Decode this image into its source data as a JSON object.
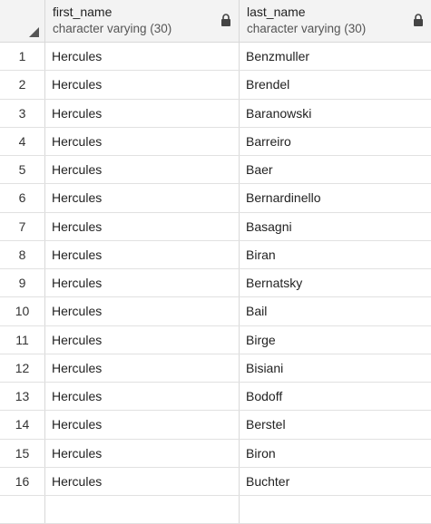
{
  "columns": [
    {
      "name": "first_name",
      "type": "character varying (30)"
    },
    {
      "name": "last_name",
      "type": "character varying (30)"
    }
  ],
  "rows": [
    {
      "num": "1",
      "first_name": "Hercules",
      "last_name": "Benzmuller"
    },
    {
      "num": "2",
      "first_name": "Hercules",
      "last_name": "Brendel"
    },
    {
      "num": "3",
      "first_name": "Hercules",
      "last_name": "Baranowski"
    },
    {
      "num": "4",
      "first_name": "Hercules",
      "last_name": "Barreiro"
    },
    {
      "num": "5",
      "first_name": "Hercules",
      "last_name": "Baer"
    },
    {
      "num": "6",
      "first_name": "Hercules",
      "last_name": "Bernardinello"
    },
    {
      "num": "7",
      "first_name": "Hercules",
      "last_name": "Basagni"
    },
    {
      "num": "8",
      "first_name": "Hercules",
      "last_name": "Biran"
    },
    {
      "num": "9",
      "first_name": "Hercules",
      "last_name": "Bernatsky"
    },
    {
      "num": "10",
      "first_name": "Hercules",
      "last_name": "Bail"
    },
    {
      "num": "11",
      "first_name": "Hercules",
      "last_name": "Birge"
    },
    {
      "num": "12",
      "first_name": "Hercules",
      "last_name": "Bisiani"
    },
    {
      "num": "13",
      "first_name": "Hercules",
      "last_name": "Bodoff"
    },
    {
      "num": "14",
      "first_name": "Hercules",
      "last_name": "Berstel"
    },
    {
      "num": "15",
      "first_name": "Hercules",
      "last_name": "Biron"
    },
    {
      "num": "16",
      "first_name": "Hercules",
      "last_name": "Buchter"
    },
    {
      "num": "",
      "first_name": "",
      "last_name": ""
    }
  ]
}
